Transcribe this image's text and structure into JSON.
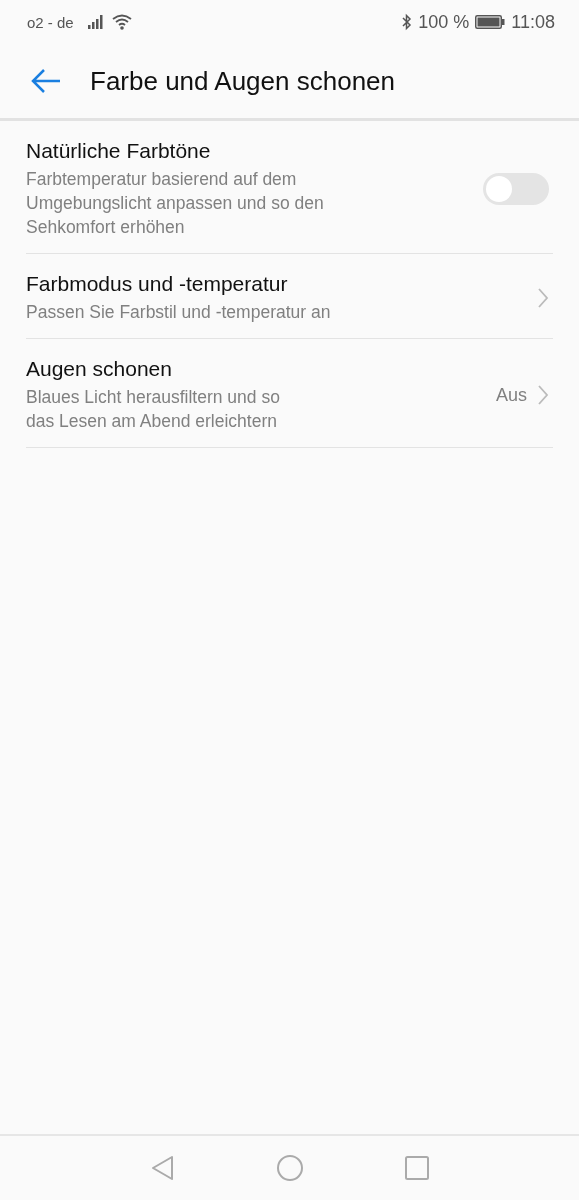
{
  "status_bar": {
    "carrier": "o2 - de",
    "battery": "100 %",
    "time": "11:08"
  },
  "header": {
    "title": "Farbe und Augen schonen"
  },
  "settings": [
    {
      "kind": "toggle",
      "title": "Natürliche Farbtöne",
      "description_lines": [
        "Farbtemperatur basierend auf dem",
        "Umgebungslicht anpassen und so den",
        "Sehkomfort erhöhen"
      ],
      "on": false
    },
    {
      "kind": "link",
      "title": "Farbmodus und -temperatur",
      "description_lines": [
        "Passen Sie Farbstil und -temperatur an"
      ]
    },
    {
      "kind": "link",
      "title": "Augen schonen",
      "description_lines": [
        "Blaues Licht herausfiltern und so",
        "das Lesen am Abend erleichtern"
      ],
      "value": "Aus"
    }
  ]
}
